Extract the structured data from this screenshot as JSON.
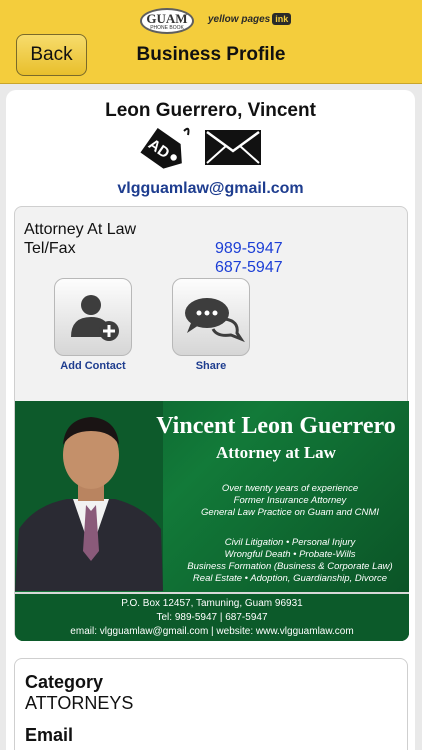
{
  "header": {
    "logo_guam": "GUAM",
    "logo_guam_sub": "PHONE BOOK",
    "logo_yellowpages": "yellow pages",
    "logo_ink": "ink",
    "back_label": "Back",
    "title": "Business Profile",
    "bg_color": "#f4cd3c"
  },
  "profile": {
    "name": "Leon Guerrero, Vincent",
    "ad_icon_text": "AD",
    "email": "vlgguamlaw@gmail.com",
    "title": "Attorney At Law",
    "tel_label": "Tel/Fax",
    "phones": [
      "989-5947",
      "687-5947"
    ],
    "actions": {
      "add_contact": "Add Contact",
      "share": "Share"
    }
  },
  "business_card": {
    "name": "Vincent Leon Guerrero",
    "role": "Attorney at Law",
    "experience_lines": [
      "Over twenty years of experience",
      "Former Insurance Attorney",
      "General Law Practice on Guam and CNMI"
    ],
    "service_lines": [
      "Civil Litigation • Personal Injury",
      "Wrongful Death • Probate-Wills",
      "Business Formation (Business & Corporate Law)",
      "Real Estate • Adoption, Guardianship, Divorce"
    ],
    "footer_lines": [
      "P.O. Box 12457, Tamuning, Guam 96931",
      "Tel: 989-5947 | 687-5947",
      "email: vlgguamlaw@gmail.com | website: www.vlgguamlaw.com"
    ]
  },
  "details": {
    "category_label": "Category",
    "category_value": "ATTORNEYS",
    "email_label": "Email"
  },
  "colors": {
    "link_blue": "#1e3d8f",
    "phone_blue": "#1c3fd6",
    "card_green": "#0b5b2b"
  }
}
